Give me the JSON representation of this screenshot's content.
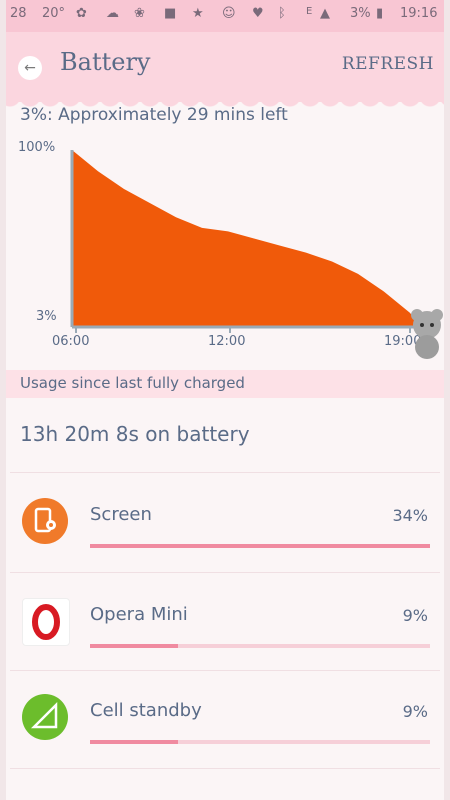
{
  "status": {
    "date": "28",
    "temp": "20°",
    "signal": "E",
    "battery_pct": "3%",
    "time": "19:16"
  },
  "header": {
    "back_icon": "arrow-left-icon",
    "title": "Battery",
    "refresh": "REFRESH"
  },
  "estimate": "3%: Approximately 29 mins left",
  "chart_data": {
    "type": "area",
    "y_labels": [
      "100%",
      "3%"
    ],
    "x_labels": [
      "06:00",
      "12:00",
      "19:00"
    ],
    "ylim": [
      0,
      100
    ],
    "x_hours": [
      6.0,
      7.0,
      8.0,
      9.0,
      10.0,
      11.0,
      12.0,
      13.0,
      14.0,
      15.0,
      16.0,
      17.0,
      18.0,
      19.0,
      19.27
    ],
    "values": [
      100,
      88,
      78,
      70,
      62,
      56,
      54,
      50,
      46,
      42,
      37,
      30,
      20,
      8,
      3
    ],
    "color": "#f05a0a"
  },
  "banner": "Usage since last fully charged",
  "duration": "13h 20m 8s on battery",
  "items": [
    {
      "name": "Screen",
      "pct": "34%",
      "fraction": 1.0,
      "icon": "screen-settings-icon",
      "color": "#f07a2a"
    },
    {
      "name": "Opera Mini",
      "pct": "9%",
      "fraction": 0.26,
      "icon": "opera-icon",
      "color": "#d81a23"
    },
    {
      "name": "Cell standby",
      "pct": "9%",
      "fraction": 0.26,
      "icon": "cell-signal-icon",
      "color": "#6cbd2c"
    }
  ]
}
